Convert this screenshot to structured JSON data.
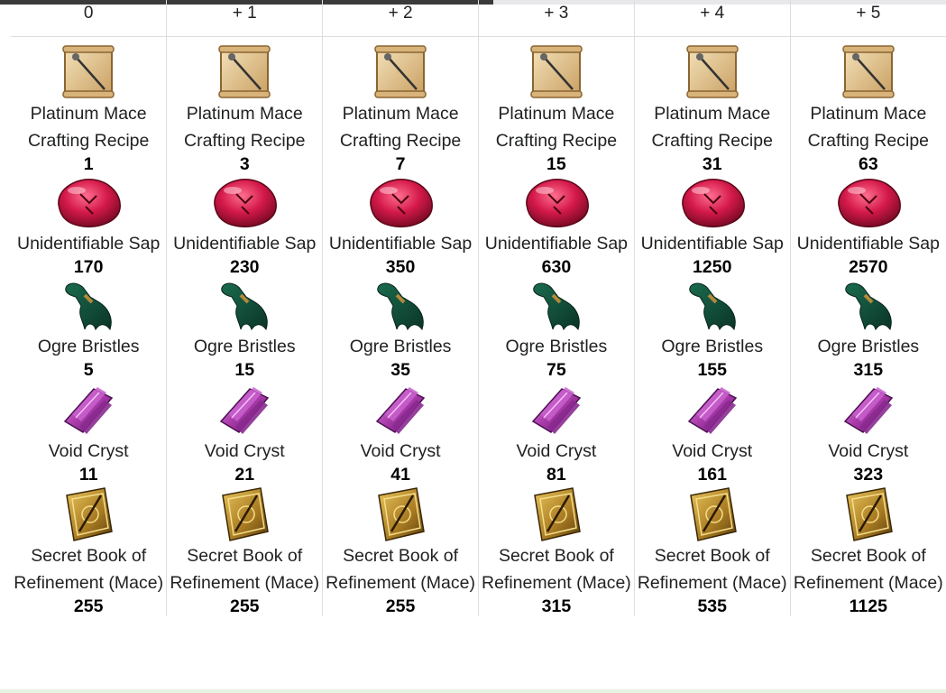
{
  "tiers": [
    {
      "label": "0",
      "materials": [
        {
          "name": "Platinum Mace Crafting Recipe",
          "icon": "scroll-recipe-icon",
          "qty": "1"
        },
        {
          "name": "Unidentifiable Sap",
          "icon": "red-gem-sap-icon",
          "qty": "170"
        },
        {
          "name": "Ogre Bristles",
          "icon": "green-bristles-icon",
          "qty": "5"
        },
        {
          "name": "Void Cryst",
          "icon": "purple-crystal-icon",
          "qty": "11"
        },
        {
          "name": "Secret Book of Refinement (Mace)",
          "icon": "golden-book-icon",
          "qty": "255"
        }
      ]
    },
    {
      "label": "+ 1",
      "materials": [
        {
          "name": "Platinum Mace Crafting Recipe",
          "icon": "scroll-recipe-icon",
          "qty": "3"
        },
        {
          "name": "Unidentifiable Sap",
          "icon": "red-gem-sap-icon",
          "qty": "230"
        },
        {
          "name": "Ogre Bristles",
          "icon": "green-bristles-icon",
          "qty": "15"
        },
        {
          "name": "Void Cryst",
          "icon": "purple-crystal-icon",
          "qty": "21"
        },
        {
          "name": "Secret Book of Refinement (Mace)",
          "icon": "golden-book-icon",
          "qty": "255"
        }
      ]
    },
    {
      "label": "+ 2",
      "materials": [
        {
          "name": "Platinum Mace Crafting Recipe",
          "icon": "scroll-recipe-icon",
          "qty": "7"
        },
        {
          "name": "Unidentifiable Sap",
          "icon": "red-gem-sap-icon",
          "qty": "350"
        },
        {
          "name": "Ogre Bristles",
          "icon": "green-bristles-icon",
          "qty": "35"
        },
        {
          "name": "Void Cryst",
          "icon": "purple-crystal-icon",
          "qty": "41"
        },
        {
          "name": "Secret Book of Refinement (Mace)",
          "icon": "golden-book-icon",
          "qty": "255"
        }
      ]
    },
    {
      "label": "+ 3",
      "materials": [
        {
          "name": "Platinum Mace Crafting Recipe",
          "icon": "scroll-recipe-icon",
          "qty": "15"
        },
        {
          "name": "Unidentifiable Sap",
          "icon": "red-gem-sap-icon",
          "qty": "630"
        },
        {
          "name": "Ogre Bristles",
          "icon": "green-bristles-icon",
          "qty": "75"
        },
        {
          "name": "Void Cryst",
          "icon": "purple-crystal-icon",
          "qty": "81"
        },
        {
          "name": "Secret Book of Refinement (Mace)",
          "icon": "golden-book-icon",
          "qty": "315"
        }
      ]
    },
    {
      "label": "+ 4",
      "materials": [
        {
          "name": "Platinum Mace Crafting Recipe",
          "icon": "scroll-recipe-icon",
          "qty": "31"
        },
        {
          "name": "Unidentifiable Sap",
          "icon": "red-gem-sap-icon",
          "qty": "1250"
        },
        {
          "name": "Ogre Bristles",
          "icon": "green-bristles-icon",
          "qty": "155"
        },
        {
          "name": "Void Cryst",
          "icon": "purple-crystal-icon",
          "qty": "161"
        },
        {
          "name": "Secret Book of Refinement (Mace)",
          "icon": "golden-book-icon",
          "qty": "535"
        }
      ]
    },
    {
      "label": "+ 5",
      "materials": [
        {
          "name": "Platinum Mace Crafting Recipe",
          "icon": "scroll-recipe-icon",
          "qty": "63"
        },
        {
          "name": "Unidentifiable Sap",
          "icon": "red-gem-sap-icon",
          "qty": "2570"
        },
        {
          "name": "Ogre Bristles",
          "icon": "green-bristles-icon",
          "qty": "315"
        },
        {
          "name": "Void Cryst",
          "icon": "purple-crystal-icon",
          "qty": "323"
        },
        {
          "name": "Secret Book of Refinement (Mace)",
          "icon": "golden-book-icon",
          "qty": "1125"
        }
      ]
    }
  ],
  "colors": {
    "border": "#dedede",
    "text": "#202122",
    "qty": "#000000"
  }
}
